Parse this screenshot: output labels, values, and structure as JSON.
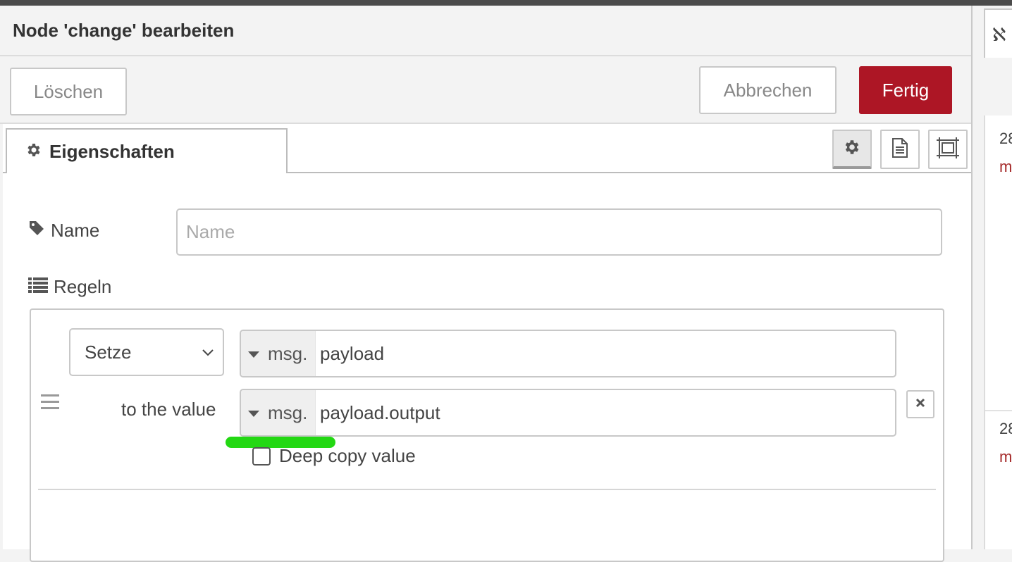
{
  "dialog": {
    "title": "Node 'change' bearbeiten",
    "buttons": {
      "delete": "Löschen",
      "cancel": "Abbrechen",
      "done": "Fertig"
    }
  },
  "tab": {
    "label": "Eigenschaften",
    "icon": "gear-icon"
  },
  "tab_icons": [
    "gear-icon",
    "description-icon",
    "appearance-icon"
  ],
  "name_field": {
    "label": "Name",
    "placeholder": "Name",
    "value": ""
  },
  "rules": {
    "label": "Regeln",
    "rule": {
      "action": "Setze",
      "property": {
        "type": "msg.",
        "value": "payload"
      },
      "to_label": "to the value",
      "target": {
        "type": "msg.",
        "value": "payload.output"
      },
      "deep_copy_label": "Deep copy value",
      "deep_copy_checked": false
    }
  },
  "side_panel": {
    "tab_glyph": "ℵ",
    "snippets": [
      "28",
      "m",
      "28",
      "m"
    ]
  },
  "colors": {
    "primary_button": "#ad1625",
    "highlight": "#23d813"
  }
}
